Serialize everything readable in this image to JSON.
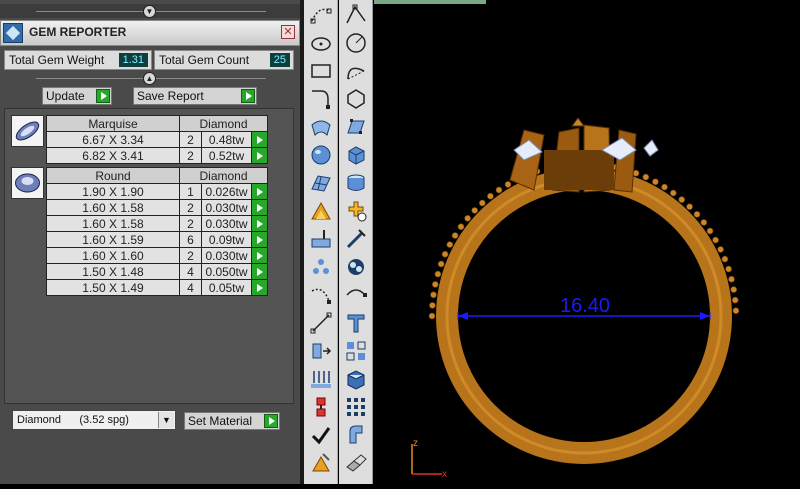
{
  "panel": {
    "title": "GEM REPORTER",
    "close_glyph": "✕",
    "logo_icon": "gem-reporter-logo",
    "total_weight_label": "Total Gem Weight",
    "total_weight_value": "1.31",
    "total_count_label": "Total Gem Count",
    "total_count_value": "25",
    "update_label": "Update",
    "save_label": "Save Report",
    "collapse_glyph": "▲",
    "collapse_top_glyph": "▼"
  },
  "groups": [
    {
      "shape": "Marquise",
      "material": "Diamond",
      "rows": [
        {
          "size": "6.67 X 3.34",
          "count": "2",
          "ctw": "0.48tw"
        },
        {
          "size": "6.82 X 3.41",
          "count": "2",
          "ctw": "0.52tw"
        }
      ]
    },
    {
      "shape": "Round",
      "material": "Diamond",
      "rows": [
        {
          "size": "1.90 X 1.90",
          "count": "1",
          "ctw": "0.026tw"
        },
        {
          "size": "1.60 X 1.58",
          "count": "2",
          "ctw": "0.030tw"
        },
        {
          "size": "1.60 X 1.58",
          "count": "2",
          "ctw": "0.030tw"
        },
        {
          "size": "1.60 X 1.59",
          "count": "6",
          "ctw": "0.09tw"
        },
        {
          "size": "1.60 X 1.60",
          "count": "2",
          "ctw": "0.030tw"
        },
        {
          "size": "1.50 X 1.48",
          "count": "4",
          "ctw": "0.050tw"
        },
        {
          "size": "1.50 X 1.49",
          "count": "4",
          "ctw": "0.05tw"
        }
      ]
    }
  ],
  "material_select": {
    "value": "Diamond      (3.52 spg)",
    "set_label": "Set Material"
  },
  "viewport": {
    "dimension_label": "16.40",
    "axis_z": "z",
    "axis_x": "x"
  },
  "colors": {
    "gold": "#b8741a",
    "dimension": "#1a1aff",
    "go_button": "#27a82b"
  }
}
